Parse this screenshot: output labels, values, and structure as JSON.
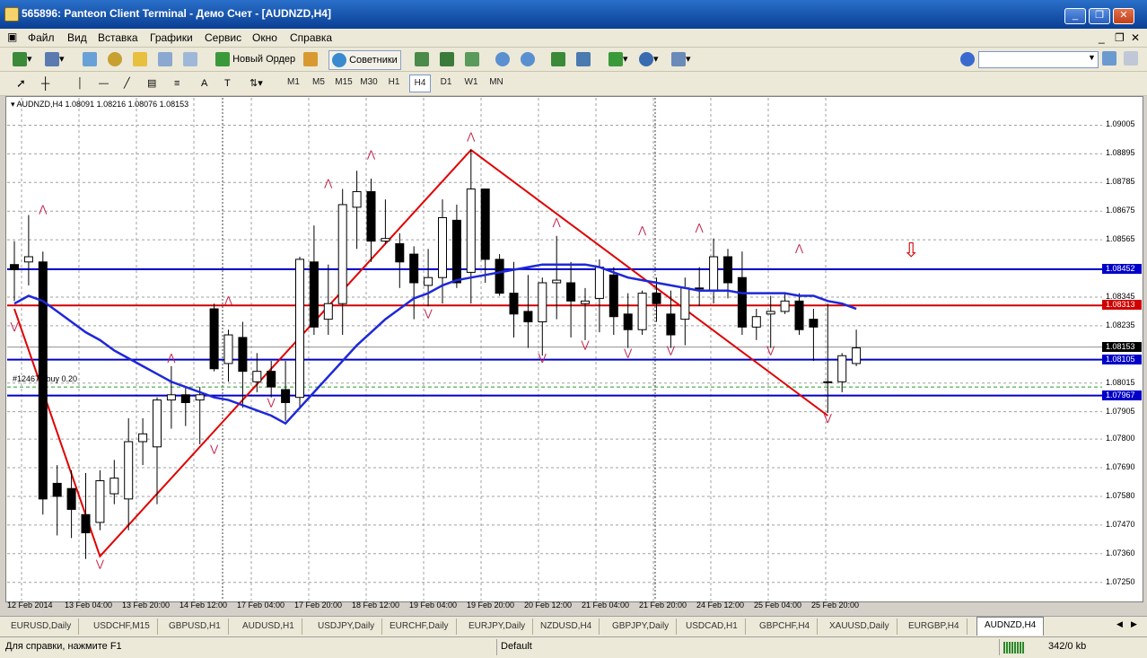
{
  "window": {
    "title": "565896: Panteon Client Terminal - Демо Счет - [AUDNZD,H4]"
  },
  "menu": [
    "Файл",
    "Вид",
    "Вставка",
    "Графики",
    "Сервис",
    "Окно",
    "Справка"
  ],
  "toolbar": {
    "new_order": "Новый Ордер",
    "experts": "Советники"
  },
  "timeframes": [
    "M1",
    "M5",
    "M15",
    "M30",
    "H1",
    "H4",
    "D1",
    "W1",
    "MN"
  ],
  "active_timeframe": "H4",
  "chart": {
    "header": "AUDNZD,H4  1.08091 1.08216 1.08076 1.08153",
    "order_label": "#124674 buy 0.20",
    "price_ticks": [
      "1.09005",
      "1.08895",
      "1.08785",
      "1.08675",
      "1.08565",
      "1.08345",
      "1.08235",
      "1.08015",
      "1.07905",
      "1.07800",
      "1.07690",
      "1.07580",
      "1.07470",
      "1.07360",
      "1.07250"
    ],
    "price_tags": {
      "level_high": "1.08452",
      "level_red": "1.08313",
      "current": "1.08153",
      "level_mid": "1.08105",
      "level_low": "1.07967"
    },
    "time_labels": [
      "12 Feb 2014",
      "13 Feb 04:00",
      "13 Feb 20:00",
      "14 Feb 12:00",
      "17 Feb 04:00",
      "17 Feb 20:00",
      "18 Feb 12:00",
      "19 Feb 04:00",
      "19 Feb 20:00",
      "20 Feb 12:00",
      "21 Feb 04:00",
      "21 Feb 20:00",
      "24 Feb 12:00",
      "25 Feb 04:00",
      "25 Feb 20:00"
    ],
    "colors": {
      "hline": "#0000c8",
      "redline": "#d00000",
      "zigzag": "#e00000",
      "ma": "#1e28d8",
      "fractal": "#c0204a"
    }
  },
  "chart_data": {
    "type": "candlestick",
    "symbol": "AUDNZD",
    "timeframe": "H4",
    "ylim": [
      1.0718,
      1.0911
    ],
    "candles": [
      {
        "o": 1.0847,
        "h": 1.0856,
        "l": 1.0833,
        "c": 1.0845
      },
      {
        "o": 1.0848,
        "h": 1.0866,
        "l": 1.0839,
        "c": 1.085
      },
      {
        "o": 1.0848,
        "h": 1.0852,
        "l": 1.0751,
        "c": 1.0757
      },
      {
        "o": 1.0763,
        "h": 1.077,
        "l": 1.0743,
        "c": 1.0758
      },
      {
        "o": 1.0761,
        "h": 1.0768,
        "l": 1.0742,
        "c": 1.0753
      },
      {
        "o": 1.0751,
        "h": 1.0767,
        "l": 1.0734,
        "c": 1.0744
      },
      {
        "o": 1.0748,
        "h": 1.0768,
        "l": 1.0745,
        "c": 1.0764
      },
      {
        "o": 1.0759,
        "h": 1.0772,
        "l": 1.0755,
        "c": 1.0765
      },
      {
        "o": 1.0757,
        "h": 1.0788,
        "l": 1.0745,
        "c": 1.0779
      },
      {
        "o": 1.0779,
        "h": 1.0788,
        "l": 1.077,
        "c": 1.0782
      },
      {
        "o": 1.0777,
        "h": 1.0796,
        "l": 1.0755,
        "c": 1.0795
      },
      {
        "o": 1.0795,
        "h": 1.0808,
        "l": 1.0784,
        "c": 1.0797
      },
      {
        "o": 1.0797,
        "h": 1.08,
        "l": 1.0785,
        "c": 1.0794
      },
      {
        "o": 1.0795,
        "h": 1.08,
        "l": 1.0778,
        "c": 1.0797
      },
      {
        "o": 1.083,
        "h": 1.0832,
        "l": 1.0806,
        "c": 1.0807
      },
      {
        "o": 1.0809,
        "h": 1.0822,
        "l": 1.0802,
        "c": 1.082
      },
      {
        "o": 1.0819,
        "h": 1.0825,
        "l": 1.0792,
        "c": 1.0806
      },
      {
        "o": 1.0802,
        "h": 1.0813,
        "l": 1.0798,
        "c": 1.0806
      },
      {
        "o": 1.0806,
        "h": 1.081,
        "l": 1.0796,
        "c": 1.08
      },
      {
        "o": 1.0799,
        "h": 1.081,
        "l": 1.0787,
        "c": 1.0794
      },
      {
        "o": 1.0796,
        "h": 1.085,
        "l": 1.0792,
        "c": 1.0849
      },
      {
        "o": 1.0848,
        "h": 1.0862,
        "l": 1.082,
        "c": 1.0823
      },
      {
        "o": 1.0826,
        "h": 1.0847,
        "l": 1.082,
        "c": 1.0832
      },
      {
        "o": 1.0832,
        "h": 1.0876,
        "l": 1.082,
        "c": 1.087
      },
      {
        "o": 1.0869,
        "h": 1.0883,
        "l": 1.0853,
        "c": 1.0875
      },
      {
        "o": 1.0875,
        "h": 1.088,
        "l": 1.0848,
        "c": 1.0856
      },
      {
        "o": 1.0856,
        "h": 1.0872,
        "l": 1.0855,
        "c": 1.0857
      },
      {
        "o": 1.0855,
        "h": 1.0859,
        "l": 1.0838,
        "c": 1.0848
      },
      {
        "o": 1.0851,
        "h": 1.0854,
        "l": 1.0826,
        "c": 1.084
      },
      {
        "o": 1.0839,
        "h": 1.0853,
        "l": 1.0831,
        "c": 1.0842
      },
      {
        "o": 1.0842,
        "h": 1.0872,
        "l": 1.0832,
        "c": 1.0865
      },
      {
        "o": 1.0864,
        "h": 1.087,
        "l": 1.0838,
        "c": 1.084
      },
      {
        "o": 1.0844,
        "h": 1.0891,
        "l": 1.0832,
        "c": 1.0876
      },
      {
        "o": 1.0876,
        "h": 1.0868,
        "l": 1.084,
        "c": 1.0849
      },
      {
        "o": 1.0849,
        "h": 1.0851,
        "l": 1.0835,
        "c": 1.0836
      },
      {
        "o": 1.0836,
        "h": 1.0848,
        "l": 1.0819,
        "c": 1.0828
      },
      {
        "o": 1.0829,
        "h": 1.0843,
        "l": 1.0815,
        "c": 1.0825
      },
      {
        "o": 1.0825,
        "h": 1.0842,
        "l": 1.0812,
        "c": 1.084
      },
      {
        "o": 1.084,
        "h": 1.0858,
        "l": 1.0826,
        "c": 1.0841
      },
      {
        "o": 1.084,
        "h": 1.0848,
        "l": 1.0819,
        "c": 1.0833
      },
      {
        "o": 1.0832,
        "h": 1.0838,
        "l": 1.0818,
        "c": 1.0833
      },
      {
        "o": 1.0834,
        "h": 1.0849,
        "l": 1.0821,
        "c": 1.0846
      },
      {
        "o": 1.0843,
        "h": 1.0846,
        "l": 1.082,
        "c": 1.0827
      },
      {
        "o": 1.0828,
        "h": 1.0836,
        "l": 1.0815,
        "c": 1.0822
      },
      {
        "o": 1.0822,
        "h": 1.0837,
        "l": 1.082,
        "c": 1.0836
      },
      {
        "o": 1.0836,
        "h": 1.0842,
        "l": 1.0825,
        "c": 1.0832
      },
      {
        "o": 1.0828,
        "h": 1.0837,
        "l": 1.0815,
        "c": 1.082
      },
      {
        "o": 1.0826,
        "h": 1.0842,
        "l": 1.0816,
        "c": 1.0838
      },
      {
        "o": 1.0838,
        "h": 1.0846,
        "l": 1.0831,
        "c": 1.0838
      },
      {
        "o": 1.0837,
        "h": 1.0857,
        "l": 1.0832,
        "c": 1.085
      },
      {
        "o": 1.085,
        "h": 1.0853,
        "l": 1.0834,
        "c": 1.084
      },
      {
        "o": 1.0842,
        "h": 1.0852,
        "l": 1.082,
        "c": 1.0823
      },
      {
        "o": 1.0823,
        "h": 1.083,
        "l": 1.0818,
        "c": 1.0827
      },
      {
        "o": 1.0828,
        "h": 1.0835,
        "l": 1.0815,
        "c": 1.0829
      },
      {
        "o": 1.0829,
        "h": 1.0836,
        "l": 1.0828,
        "c": 1.0833
      },
      {
        "o": 1.0833,
        "h": 1.0836,
        "l": 1.082,
        "c": 1.0822
      },
      {
        "o": 1.0826,
        "h": 1.083,
        "l": 1.081,
        "c": 1.0823
      },
      {
        "o": 1.0802,
        "h": 1.0832,
        "l": 1.079,
        "c": 1.0802
      },
      {
        "o": 1.0802,
        "h": 1.0813,
        "l": 1.0798,
        "c": 1.0812
      },
      {
        "o": 1.0809,
        "h": 1.0822,
        "l": 1.0808,
        "c": 1.0815
      }
    ],
    "moving_average": [
      1.0832,
      1.0835,
      1.0833,
      1.0829,
      1.0825,
      1.0821,
      1.0818,
      1.0814,
      1.0811,
      1.0808,
      1.0805,
      1.0802,
      1.08,
      1.0798,
      1.0796,
      1.0795,
      1.0793,
      1.0791,
      1.0789,
      1.0786,
      1.0792,
      1.0798,
      1.0804,
      1.081,
      1.0816,
      1.0821,
      1.0826,
      1.083,
      1.0834,
      1.0836,
      1.0839,
      1.0841,
      1.0842,
      1.0843,
      1.0844,
      1.0845,
      1.0846,
      1.0847,
      1.0847,
      1.0847,
      1.0847,
      1.0846,
      1.0844,
      1.0842,
      1.0841,
      1.084,
      1.0839,
      1.0838,
      1.0837,
      1.0837,
      1.0837,
      1.0836,
      1.0836,
      1.0836,
      1.0836,
      1.0835,
      1.0835,
      1.0833,
      1.0832,
      1.083
    ],
    "horizontal_lines": [
      1.08452,
      1.08313,
      1.08105,
      1.07967
    ],
    "zigzag": [
      [
        0,
        1.083
      ],
      [
        6,
        1.0735
      ],
      [
        32,
        1.0891
      ],
      [
        57,
        1.0789
      ]
    ],
    "fractals_up": [
      [
        2,
        1.0867
      ],
      [
        11,
        1.081
      ],
      [
        15,
        1.0832
      ],
      [
        22,
        1.0877
      ],
      [
        25,
        1.0888
      ],
      [
        32,
        1.0895
      ],
      [
        38,
        1.0862
      ],
      [
        44,
        1.0859
      ],
      [
        48,
        1.086
      ],
      [
        55,
        1.0852
      ]
    ],
    "fractals_down": [
      [
        0,
        1.0822
      ],
      [
        6,
        1.0731
      ],
      [
        14,
        1.0775
      ],
      [
        18,
        1.0793
      ],
      [
        29,
        1.0827
      ],
      [
        37,
        1.081
      ],
      [
        40,
        1.0815
      ],
      [
        43,
        1.0812
      ],
      [
        46,
        1.0813
      ],
      [
        53,
        1.0813
      ],
      [
        57,
        1.0787
      ]
    ]
  },
  "tabs": [
    "EURUSD,Daily",
    "USDCHF,M15",
    "GBPUSD,H1",
    "AUDUSD,H1",
    "USDJPY,Daily",
    "EURCHF,Daily",
    "EURJPY,Daily",
    "NZDUSD,H4",
    "GBPJPY,Daily",
    "USDCAD,H1",
    "GBPCHF,H4",
    "XAUUSD,Daily",
    "EURGBP,H4",
    "AUDNZD,H4"
  ],
  "active_tab": "AUDNZD,H4",
  "status": {
    "help": "Для справки, нажмите F1",
    "profile": "Default",
    "traffic": "342/0 kb"
  }
}
